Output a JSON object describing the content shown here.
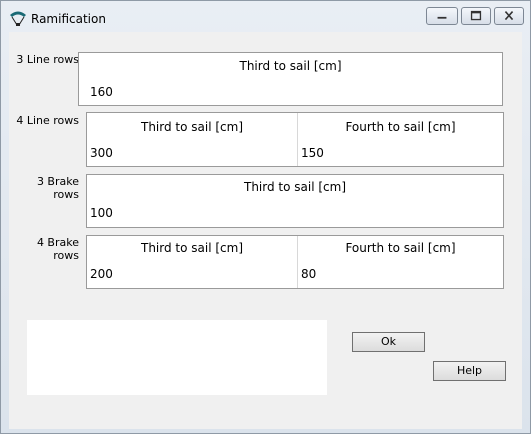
{
  "window": {
    "title": "Ramification"
  },
  "rows": [
    {
      "label": "3 Line rows",
      "columns": [
        {
          "header": "Third to sail [cm]",
          "value": "160"
        }
      ]
    },
    {
      "label": "4 Line rows",
      "columns": [
        {
          "header": "Third to sail [cm]",
          "value": "300"
        },
        {
          "header": "Fourth to sail [cm]",
          "value": "150"
        }
      ]
    },
    {
      "label": "3 Brake rows",
      "columns": [
        {
          "header": "Third to sail [cm]",
          "value": "100"
        }
      ]
    },
    {
      "label": "4 Brake rows",
      "columns": [
        {
          "header": "Third to sail [cm]",
          "value": "200"
        },
        {
          "header": "Fourth to sail [cm]",
          "value": "80"
        }
      ]
    }
  ],
  "buttons": {
    "ok": "Ok",
    "help": "Help"
  },
  "icons": {
    "app": "paraglider-icon",
    "minimize": "minimize-icon",
    "maximize": "maximize-icon",
    "close": "close-icon"
  }
}
